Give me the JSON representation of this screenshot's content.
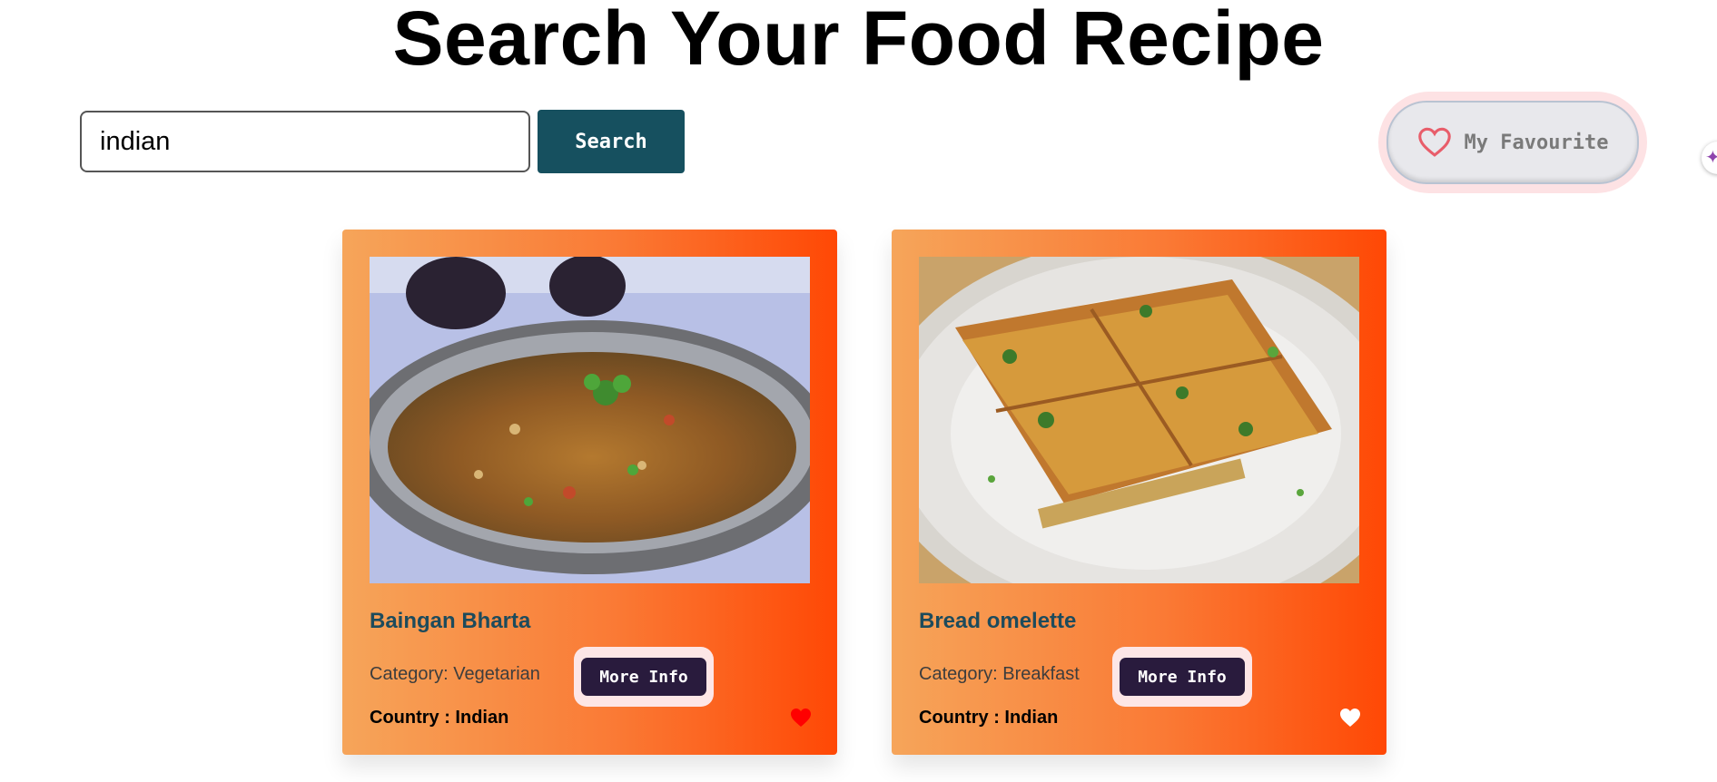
{
  "header": {
    "title": "Search Your Food Recipe"
  },
  "search": {
    "value": "indian",
    "button_label": "Search"
  },
  "favourite": {
    "label": "My Favourite"
  },
  "colors": {
    "search_button": "#16505f",
    "card_gradient_start": "#f6a55a",
    "card_gradient_end": "#ff4805",
    "card_title": "#1d4b5c",
    "more_info_button": "#291b3d",
    "heart_active": "#ff0000",
    "heart_inactive": "#ffffff",
    "favourite_heart_outline": "#e85d6a"
  },
  "icons": {
    "favourite": "heart-outline-icon",
    "card_favourite": "heart-icon",
    "edge_widget": "sparkle-icon"
  },
  "recipes": [
    {
      "name": "Baingan Bharta",
      "category": "Category: Vegetarian",
      "country": "Country : Indian",
      "more_info_label": "More Info",
      "favourited": true,
      "image": "photo of baingan bharta in a steel plate"
    },
    {
      "name": "Bread omelette",
      "category": "Category: Breakfast",
      "country": "Country : Indian",
      "more_info_label": "More Info",
      "favourited": false,
      "image": "photo of bread omelette on a white plate"
    }
  ]
}
